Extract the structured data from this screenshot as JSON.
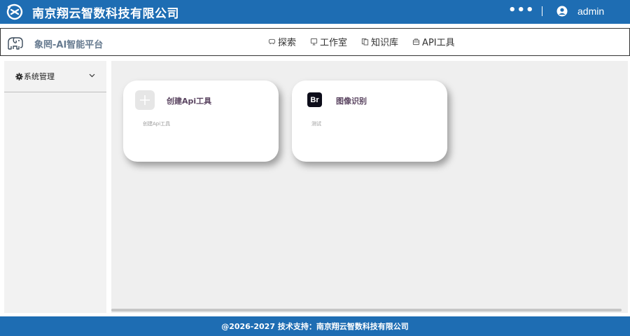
{
  "header": {
    "company": "南京翔云智数科技有限公司",
    "more": "•••",
    "username": "admin"
  },
  "subheader": {
    "app_title": "象罔-AI智能平台",
    "nav": [
      {
        "label": "探索",
        "icon": "explore-icon"
      },
      {
        "label": "工作室",
        "icon": "studio-icon"
      },
      {
        "label": "知识库",
        "icon": "knowledge-icon"
      },
      {
        "label": "API工具",
        "icon": "api-tool-icon"
      }
    ]
  },
  "sidebar": {
    "items": [
      {
        "label": "系统管理",
        "icon": "gear-icon"
      }
    ]
  },
  "cards": [
    {
      "title": "创建Api工具",
      "desc": "创建Api工具",
      "icon": "plus-icon"
    },
    {
      "title": "图像识别",
      "desc": "测试",
      "icon": "br-icon",
      "icon_text": "Br"
    }
  ],
  "footer": {
    "text": "@2026-2027 技术支持：南京翔云智数科技有限公司"
  },
  "colors": {
    "brand_blue": "#1e6db3",
    "main_bg": "#efefef",
    "sidebar_bg": "#f2f2f2"
  }
}
